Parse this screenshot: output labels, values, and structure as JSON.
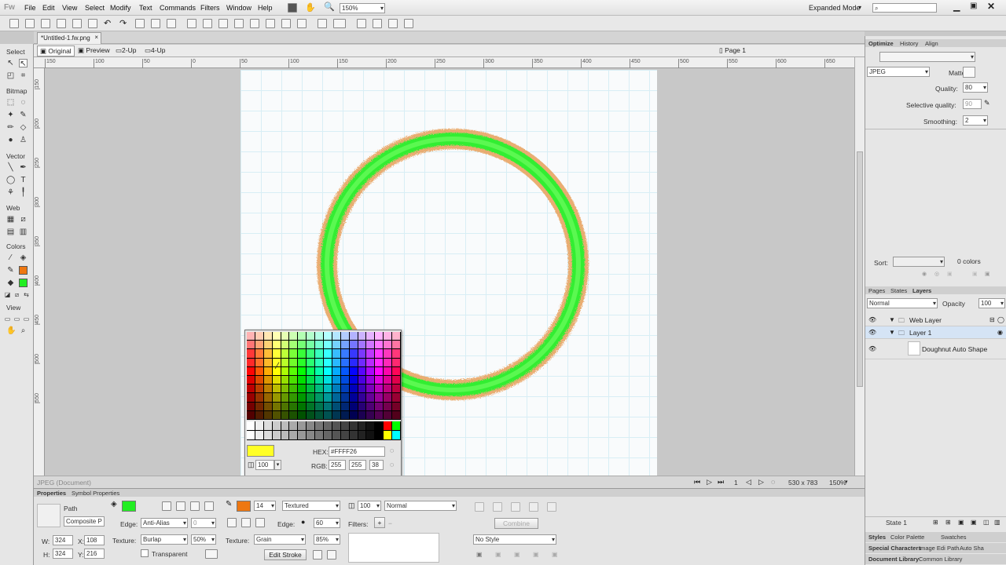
{
  "app": {
    "logo": "Fw",
    "mode": "Expanded Mode",
    "zoom_dd": "150%"
  },
  "menu": [
    "File",
    "Edit",
    "View",
    "Select",
    "Modify",
    "Text",
    "Commands",
    "Filters",
    "Window",
    "Help"
  ],
  "doc": {
    "tab": "*Untitled-1.fw.png",
    "close": "×"
  },
  "views": {
    "original": "Original",
    "preview": "Preview",
    "two_up": "2-Up",
    "four_up": "4-Up",
    "page": "Page 1"
  },
  "tools": {
    "select": "Select",
    "bitmap": "Bitmap",
    "vector": "Vector",
    "web": "Web",
    "colors": "Colors",
    "view": "View"
  },
  "ruler_h": [
    "150",
    "100",
    "50",
    "0",
    "50",
    "100",
    "150",
    "200",
    "250",
    "300",
    "350",
    "400",
    "450",
    "500",
    "550",
    "600",
    "650"
  ],
  "ruler_v": [
    "150",
    "200",
    "250",
    "300",
    "350",
    "400",
    "450",
    "500",
    "550"
  ],
  "status": {
    "left": "JPEG (Document)",
    "page_num": "1",
    "size": "530 x 783",
    "zoom": "150%"
  },
  "picker": {
    "hex_label": "HEX:",
    "hex": "#FFFF26",
    "rgb_label": "RGB:",
    "r": "255",
    "g": "255",
    "b": "38",
    "alpha": "100",
    "preview_color": "#ffff26"
  },
  "props": {
    "tabs": [
      "Properties",
      "Symbol Properties"
    ],
    "type": "Path",
    "name": "Composite P",
    "w_label": "W:",
    "w": "324",
    "x_label": "X:",
    "x": "108",
    "h_label": "H:",
    "h": "324",
    "y_label": "Y:",
    "y": "216",
    "fill_color": "#22ee22",
    "stroke_color": "#ee7711",
    "edge_label": "Edge:",
    "edge": "Anti-Alias",
    "edge_val": "0",
    "texture_label": "Texture:",
    "texture": "Burlap",
    "texture_pct": "50%",
    "transparent": "Transparent",
    "stroke_size": "14",
    "stroke_type": "Textured",
    "stroke_edge_label": "Edge:",
    "stroke_edge": "60",
    "stroke_texture_label": "Texture:",
    "stroke_texture": "Grain",
    "stroke_texture_pct": "85%",
    "edit_stroke": "Edit Stroke",
    "opacity": "100",
    "blend": "Normal",
    "filters_label": "Filters:",
    "filters_add": "+",
    "filters_remove": "−",
    "combine": "Combine",
    "style": "No Style"
  },
  "optimize": {
    "tabs": [
      "Optimize",
      "History",
      "Align"
    ],
    "format": "JPEG",
    "matte_label": "Matte:",
    "quality_label": "Quality:",
    "quality": "80",
    "selective_label": "Selective quality:",
    "selective": "90",
    "smoothing_label": "Smoothing:",
    "smoothing": "2",
    "sort_label": "Sort:",
    "colors": "0 colors"
  },
  "layers": {
    "tabs": [
      "Pages",
      "States",
      "Layers"
    ],
    "blend": "Normal",
    "opacity_label": "Opacity",
    "opacity": "100",
    "rows": [
      {
        "name": "Web Layer"
      },
      {
        "name": "Layer 1"
      },
      {
        "name": "Doughnut Auto Shape"
      }
    ],
    "state": "State 1"
  },
  "bottom_tabs": {
    "row1": [
      "Styles",
      "Color Palette",
      "Swatches"
    ],
    "row2": [
      "Special Characters",
      "Image Edi",
      "Path",
      "Auto Sha"
    ],
    "row3": [
      "Document Library",
      "Common Library"
    ]
  }
}
